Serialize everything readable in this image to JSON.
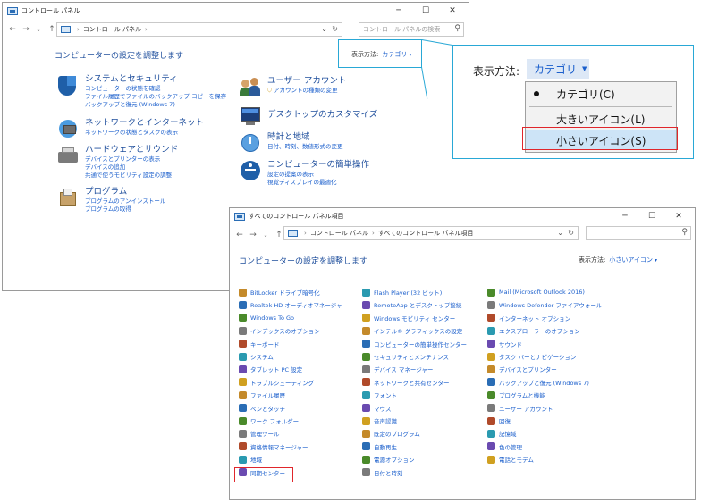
{
  "window1": {
    "title": "コントロール パネル",
    "breadcrumb": [
      "コントロール パネル"
    ],
    "search_placeholder": "コントロール パネルの検索",
    "heading": "コンピューターの設定を調整します",
    "view_by_label": "表示方法:",
    "view_by_value": "カテゴリ",
    "categories": [
      {
        "title": "システムとセキュリティ",
        "links": [
          "コンピューターの状態を確認",
          "ファイル履歴でファイルのバックアップ コピーを保存",
          "バックアップと復元 (Windows 7)"
        ]
      },
      {
        "title": "ネットワークとインターネット",
        "links": [
          "ネットワークの状態とタスクの表示"
        ]
      },
      {
        "title": "ハードウェアとサウンド",
        "links": [
          "デバイスとプリンターの表示",
          "デバイスの追加",
          "共通で使うモビリティ設定の調整"
        ]
      },
      {
        "title": "プログラム",
        "links": [
          "プログラムのアンインストール",
          "プログラムの取得"
        ]
      },
      {
        "title": "ユーザー アカウント",
        "links": [
          "アカウントの種類の変更"
        ]
      },
      {
        "title": "デスクトップのカスタマイズ",
        "links": []
      },
      {
        "title": "時計と地域",
        "links": [
          "日付、時刻、数値形式の変更"
        ]
      },
      {
        "title": "コンピューターの簡単操作",
        "links": [
          "設定の提案の表示",
          "視覚ディスプレイの最適化"
        ]
      }
    ]
  },
  "callout": {
    "label": "表示方法:",
    "button": "カテゴリ",
    "menu": [
      "カテゴリ(C)",
      "大きいアイコン(L)",
      "小さいアイコン(S)"
    ]
  },
  "window2": {
    "title": "すべてのコントロール パネル項目",
    "breadcrumb": [
      "コントロール パネル",
      "すべてのコントロール パネル項目"
    ],
    "heading": "コンピューターの設定を調整します",
    "view_by_label": "表示方法:",
    "view_by_value": "小さいアイコン",
    "columns": [
      [
        "BitLocker ドライブ暗号化",
        "Realtek HD オーディオマネージャ",
        "Windows To Go",
        "インデックスのオプション",
        "キーボード",
        "システム",
        "タブレット PC 設定",
        "トラブルシューティング",
        "ファイル履歴",
        "ペンとタッチ",
        "ワーク フォルダー",
        "管理ツール",
        "資格情報マネージャー",
        "地域",
        "同期センター"
      ],
      [
        "Flash Player (32 ビット)",
        "RemoteApp とデスクトップ接続",
        "Windows モビリティ センター",
        "インテル® グラフィックスの設定",
        "コンピューターの簡単操作センター",
        "セキュリティとメンテナンス",
        "デバイス マネージャー",
        "ネットワークと共有センター",
        "フォント",
        "マウス",
        "音声認識",
        "既定のプログラム",
        "自動再生",
        "電源オプション",
        "日付と時刻"
      ],
      [
        "Mail (Microsoft Outlook 2016)",
        "Windows Defender ファイアウォール",
        "インターネット オプション",
        "エクスプローラーのオプション",
        "サウンド",
        "タスク バーとナビゲーション",
        "デバイスとプリンター",
        "バックアップと復元 (Windows 7)",
        "プログラムと機能",
        "ユーザー アカウント",
        "回復",
        "記憶域",
        "色の管理",
        "電話とモデム"
      ]
    ],
    "icon_colors": [
      "#c48a2a",
      "#2a6db5",
      "#4a8a2a",
      "#7a7a7a",
      "#b04a2a",
      "#2a9ab0",
      "#6a4ab0",
      "#d0a020"
    ]
  },
  "colors": {
    "link": "#1b5fcc",
    "heading": "#1e4e9c",
    "callout_border": "#29a8d6",
    "highlight_box": "#e0262b",
    "selected_bg": "#cde4f7"
  }
}
